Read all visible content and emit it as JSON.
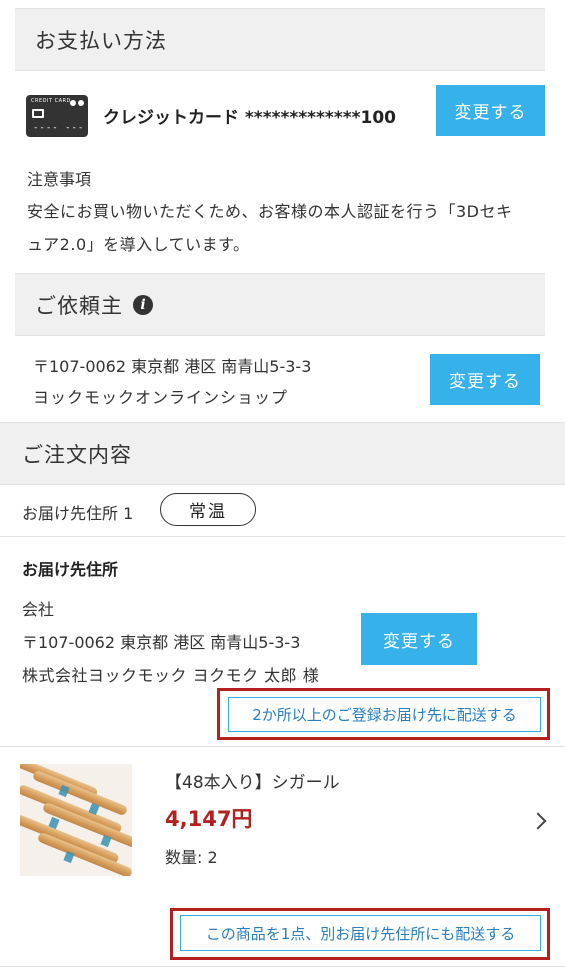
{
  "payment": {
    "title": "お支払い方法",
    "card_brand_text": "CREDIT CARD",
    "card_icon_digits": "---- ----",
    "card_label": "クレジットカード *************100",
    "change_label": "変更する",
    "notice_title": "注意事項",
    "notice_line1": "安全にお買い物いただくため、お客様の本人認証を行う「3Dセキ",
    "notice_line2": "ュア2.0」を導入しています。"
  },
  "requester": {
    "title": "ご依頼主",
    "info_icon": "info-icon",
    "address_line": "〒107-0062 東京都 港区 南青山5-3-3",
    "name_line": "ヨックモックオンラインショップ",
    "change_label": "変更する"
  },
  "order": {
    "title": "ご注文内容",
    "destination_label": "お届け先住所 1",
    "temperature_badge": "常温",
    "shipping_heading": "お届け先住所",
    "company_line": "会社",
    "address_line": "〒107-0062 東京都 港区 南青山5-3-3",
    "recipient_line": "株式会社ヨックモック ヨクモク 太郎 様",
    "change_label": "変更する",
    "multi_ship_label": "2か所以上のご登録お届け先に配送する",
    "product": {
      "name": "【48本入り】シガール",
      "price": "4,147円",
      "quantity": "数量: 2",
      "split_ship_label": "この商品を1点、別お届け先住所にも配送する"
    }
  },
  "colors": {
    "accent_blue": "#37b1ea",
    "price_red": "#b3201f",
    "highlight_frame": "#b3201f"
  }
}
